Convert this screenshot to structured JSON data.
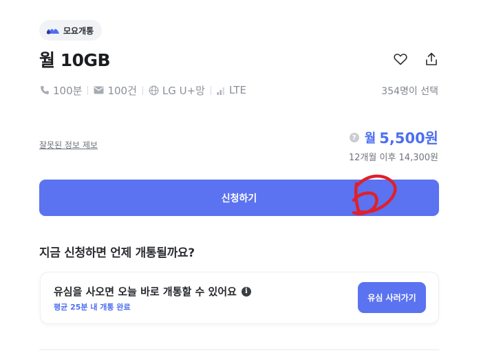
{
  "brand": {
    "name": "모요개통",
    "icon": "moyo-logo-icon"
  },
  "plan": {
    "title": "월 10GB"
  },
  "actions": {
    "like_icon": "heart-icon",
    "share_icon": "share-icon"
  },
  "specs": [
    {
      "icon": "phone-icon",
      "label": "100분"
    },
    {
      "icon": "message-icon",
      "label": "100건"
    },
    {
      "icon": "globe-icon",
      "label": "LG U+망"
    },
    {
      "icon": "signal-icon",
      "label": "LTE"
    }
  ],
  "choose_count": "354명이 선택",
  "report_link": "잘못된 정보 제보",
  "price": {
    "prefix": "월",
    "value": "5,500원",
    "after": "12개월 이후 14,300원"
  },
  "apply_button": "신청하기",
  "activation": {
    "section_title": "지금 신청하면 언제 개통될까요?",
    "card_title": "유심을 사오면 오늘 바로 개통할 수 있어요",
    "card_sub": "평균 25분 내 개통 완료",
    "buy_button": "유심 사러가기"
  },
  "colors": {
    "accent": "#5b73f0",
    "price": "#4d6ff0",
    "scribble": "#e0202a"
  }
}
